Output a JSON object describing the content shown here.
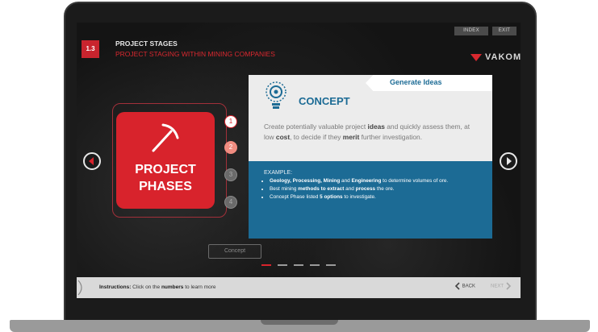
{
  "header": {
    "index_label": "INDEX",
    "exit_label": "EXIT",
    "section_number": "1.3",
    "title": "PROJECT STAGES",
    "subtitle": "PROJECT STAGING WITHIN MINING COMPANIES",
    "brand": "VAKOM"
  },
  "phases": {
    "line1": "PROJECT",
    "line2": "PHASES",
    "numbers": [
      "1",
      "2",
      "3",
      "4"
    ],
    "current": 1
  },
  "panel": {
    "tab_label": "Generate Ideas",
    "title": "CONCEPT",
    "description_parts": {
      "p1": "Create potentially valuable project ",
      "b1": "ideas",
      "p2": " and quickly assess them, at low ",
      "b2": "cost",
      "p3": ", to decide if they ",
      "b3": "merit",
      "p4": " further investigation."
    },
    "example_label": "EXAMPLE:",
    "examples": [
      {
        "b1": "Geology, Processing, Mining",
        "t1": " and ",
        "b2": "Engineering",
        "t2": " to determine volumes of ore."
      },
      {
        "t0": "Best mining ",
        "b1": "methods to extract",
        "t1": " and ",
        "b2": "process",
        "t2": " the ore."
      },
      {
        "t0": "Concept Phase listed ",
        "b1": "5 options",
        "t1": " to investigate."
      }
    ]
  },
  "concept_button_label": "Concept",
  "dots_count": 5,
  "instructions": {
    "label": "Instructions:",
    "text1": " Click on the ",
    "bold": "numbers",
    "text2": " to learn more"
  },
  "nav": {
    "back_label": "BACK",
    "next_label": "NEXT"
  },
  "colors": {
    "accent_red": "#d8232c",
    "panel_blue": "#1c6b95"
  }
}
